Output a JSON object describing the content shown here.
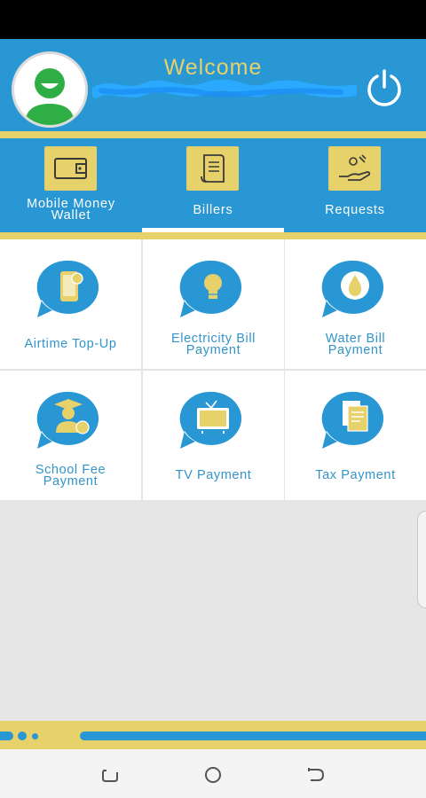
{
  "header": {
    "welcome": "Welcome",
    "username_redacted": true,
    "power_icon": "power-icon",
    "colors": {
      "primary": "#2897d4",
      "accent": "#e6d16a"
    }
  },
  "tabs": [
    {
      "label": "Mobile Money\nWallet",
      "icon": "wallet-icon",
      "active": false
    },
    {
      "label": "Billers",
      "icon": "receipt-icon",
      "active": true
    },
    {
      "label": "Requests",
      "icon": "hand-money-icon",
      "active": false
    }
  ],
  "billers": [
    {
      "label": "Airtime Top-Up",
      "icon": "phone-topup-icon"
    },
    {
      "label": "Electricity Bill\nPayment",
      "icon": "lightbulb-icon"
    },
    {
      "label": "Water Bill\nPayment",
      "icon": "water-drop-icon"
    },
    {
      "label": "School Fee\nPayment",
      "icon": "graduate-icon"
    },
    {
      "label": "TV Payment",
      "icon": "tv-icon"
    },
    {
      "label": "Tax Payment",
      "icon": "documents-icon"
    }
  ],
  "navbar": {
    "recent": "recent-apps-icon",
    "home": "home-icon",
    "back": "back-icon"
  }
}
